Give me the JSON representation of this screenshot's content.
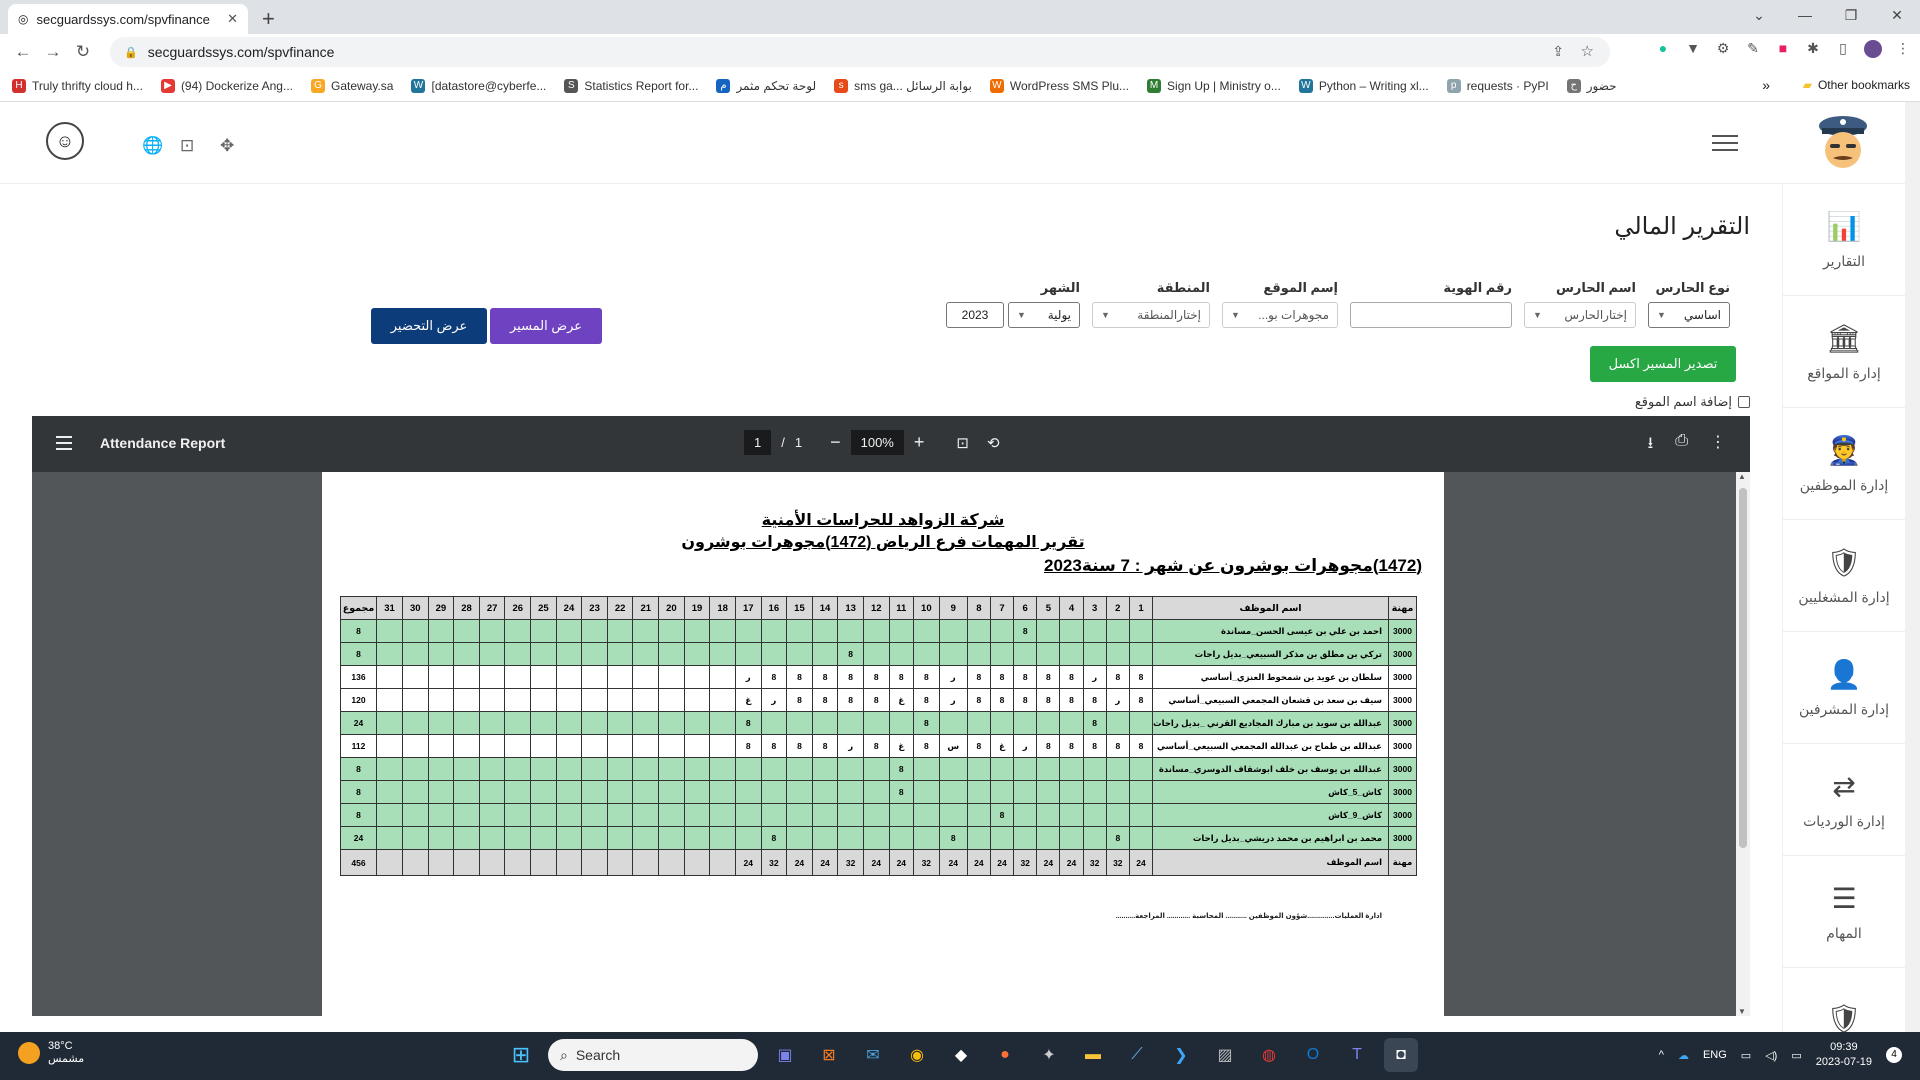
{
  "browser": {
    "tab_title": "secguardssys.com/spvfinance",
    "url": "secguardssys.com/spvfinance",
    "bookmarks": [
      {
        "label": "Truly thrifty cloud h...",
        "color": "#d32f2f",
        "glyph": "H"
      },
      {
        "label": "(94) Dockerize Ang...",
        "color": "#e53935",
        "glyph": "▶"
      },
      {
        "label": "Gateway.sa",
        "color": "#f9a825",
        "glyph": "G"
      },
      {
        "label": "[datastore@cyberfe...",
        "color": "#21759b",
        "glyph": "W"
      },
      {
        "label": "Statistics Report for...",
        "color": "#555555",
        "glyph": "S"
      },
      {
        "label": "لوحة تحكم مثمر",
        "color": "#1565c0",
        "glyph": "م"
      },
      {
        "label": "sms ga... بوابة الرسائل",
        "color": "#e64a19",
        "glyph": "s"
      },
      {
        "label": "WordPress SMS Plu...",
        "color": "#ef6c00",
        "glyph": "W"
      },
      {
        "label": "Sign Up | Ministry o...",
        "color": "#2e7d32",
        "glyph": "M"
      },
      {
        "label": "Python – Writing xl...",
        "color": "#21759b",
        "glyph": "W"
      },
      {
        "label": "requests · PyPI",
        "color": "#90a4ae",
        "glyph": "p"
      },
      {
        "label": "حضور",
        "color": "#757575",
        "glyph": "ح"
      }
    ],
    "other_bookmarks": "Other bookmarks"
  },
  "sidebar": {
    "items": [
      {
        "label": "التقارير",
        "icon": "📊"
      },
      {
        "label": "إدارة المواقع",
        "icon": "🏛"
      },
      {
        "label": "إدارة الموظفين",
        "icon": "👮"
      },
      {
        "label": "إدارة المشغليين",
        "icon": "🛡"
      },
      {
        "label": "إدارة المشرفين",
        "icon": "👤"
      },
      {
        "label": "إدارة الورديات",
        "icon": "⇄"
      },
      {
        "label": "المهام",
        "icon": "☰"
      },
      {
        "label": "",
        "icon": "🛡"
      }
    ]
  },
  "page": {
    "title": "التقرير المالي",
    "filters": {
      "guard_type": {
        "label": "نوع الحارس",
        "value": "اساسي"
      },
      "guard_name": {
        "label": "اسم الحارس",
        "value": "إختارالحارس"
      },
      "id_number": {
        "label": "رقم الهوية",
        "value": ""
      },
      "site_name": {
        "label": "إسم الموقع",
        "value": "مجوهرات بو..."
      },
      "region": {
        "label": "المنطقة",
        "value": "إختارالمنطقة"
      },
      "month": {
        "label": "الشهر",
        "value": "يولية",
        "year": "2023"
      }
    },
    "buttons": {
      "excel": "تصدير المسير اكسل",
      "route": "عرض المسير",
      "attendance": "عرض التحضير"
    },
    "checkbox_label": "إضافة اسم الموقع"
  },
  "viewer": {
    "title": "Attendance Report",
    "page_current": "1",
    "page_sep": "/",
    "page_total": "1",
    "zoom": "100%"
  },
  "report": {
    "company": "شركة الزواهد للحراسات الأمنية",
    "subtitle": "تقرير المهمات فرع الرياض (1472)مجوهرات بوشرون",
    "period": "(1472)مجوهرات بوشرون عن شهر : 7 سنة2023",
    "headers": {
      "job": "مهنة",
      "name": "اسم الموظف",
      "total": "مجموع"
    },
    "rows": [
      {
        "job": "3000",
        "name": "احمد بن علي بن عيسى الحسن_مساندة",
        "total": "8",
        "style": "g",
        "days": [
          "",
          "",
          "",
          "",
          "",
          "8",
          "",
          "",
          "",
          "",
          "",
          "",
          "",
          "",
          "",
          "",
          "",
          "",
          "",
          "",
          "",
          "",
          "",
          "",
          "",
          "",
          "",
          "",
          "",
          "",
          ""
        ]
      },
      {
        "job": "3000",
        "name": "تركي بن مطلق بن مذكر السبيعي_بديل راحات",
        "total": "8",
        "style": "g",
        "days": [
          "",
          "",
          "",
          "",
          "",
          "",
          "",
          "",
          "",
          "",
          "",
          "",
          "8",
          "",
          "",
          "",
          "",
          "",
          "",
          "",
          "",
          "",
          "",
          "",
          "",
          "",
          "",
          "",
          "",
          "",
          ""
        ]
      },
      {
        "job": "3000",
        "name": "سلطان بن عويد بن شمحوط العنزي_أساسي",
        "total": "136",
        "style": "w",
        "days": [
          "8",
          "8",
          "ر",
          "8",
          "8",
          "8",
          "8",
          "8",
          "ر",
          "8",
          "8",
          "8",
          "8",
          "8",
          "8",
          "8",
          "ر",
          "",
          "",
          "",
          "",
          "",
          "",
          "",
          "",
          "",
          "",
          "",
          "",
          "",
          ""
        ]
      },
      {
        "job": "3000",
        "name": "سيف بن سعد بن قشعان المجمعي السبيعي_أساسي",
        "total": "120",
        "style": "w",
        "days": [
          "8",
          "ر",
          "8",
          "8",
          "8",
          "8",
          "8",
          "8",
          "ر",
          "8",
          "غ",
          "8",
          "8",
          "8",
          "8",
          "ر",
          "غ",
          "",
          "",
          "",
          "",
          "",
          "",
          "",
          "",
          "",
          "",
          "",
          "",
          "",
          ""
        ]
      },
      {
        "job": "3000",
        "name": "عبدالله بن سويد بن مبارك المجاديع القرني _بديل راحات",
        "total": "24",
        "style": "g",
        "days": [
          "",
          "",
          "8",
          "",
          "",
          "",
          "",
          "",
          "",
          "8",
          "",
          "",
          "",
          "",
          "",
          "",
          "8",
          "",
          "",
          "",
          "",
          "",
          "",
          "",
          "",
          "",
          "",
          "",
          "",
          "",
          ""
        ]
      },
      {
        "job": "3000",
        "name": "عبدالله بن طماح بن عبدالله المجمعي السبيعي_أساسي",
        "total": "112",
        "style": "w",
        "days": [
          "8",
          "8",
          "8",
          "8",
          "8",
          "ر",
          "غ",
          "8",
          "س",
          "8",
          "غ",
          "8",
          "ر",
          "8",
          "8",
          "8",
          "8",
          "",
          "",
          "",
          "",
          "",
          "",
          "",
          "",
          "",
          "",
          "",
          "",
          "",
          ""
        ]
      },
      {
        "job": "3000",
        "name": "عبدالله بن يوسف بن خلف ابوشقاف الدوسري_مساندة",
        "total": "8",
        "style": "g",
        "days": [
          "",
          "",
          "",
          "",
          "",
          "",
          "",
          "",
          "",
          "",
          "8",
          "",
          "",
          "",
          "",
          "",
          "",
          "",
          "",
          "",
          "",
          "",
          "",
          "",
          "",
          "",
          "",
          "",
          "",
          "",
          ""
        ]
      },
      {
        "job": "3000",
        "name": "كاش_5_كاش",
        "total": "8",
        "style": "g",
        "days": [
          "",
          "",
          "",
          "",
          "",
          "",
          "",
          "",
          "",
          "",
          "8",
          "",
          "",
          "",
          "",
          "",
          "",
          "",
          "",
          "",
          "",
          "",
          "",
          "",
          "",
          "",
          "",
          "",
          "",
          "",
          ""
        ]
      },
      {
        "job": "3000",
        "name": "كاش_9_كاش",
        "total": "8",
        "style": "g",
        "days": [
          "",
          "",
          "",
          "",
          "",
          "",
          "8",
          "",
          "",
          "",
          "",
          "",
          "",
          "",
          "",
          "",
          "",
          "",
          "",
          "",
          "",
          "",
          "",
          "",
          "",
          "",
          "",
          "",
          "",
          "",
          ""
        ]
      },
      {
        "job": "3000",
        "name": "محمد بن ابراهيم بن محمد دريشي_بديل راحات",
        "total": "24",
        "style": "g",
        "days": [
          "",
          "8",
          "",
          "",
          "",
          "",
          "",
          "",
          "8",
          "",
          "",
          "",
          "",
          "",
          "",
          "8",
          "",
          "",
          "",
          "",
          "",
          "",
          "",
          "",
          "",
          "",
          "",
          "",
          "",
          "",
          ""
        ]
      }
    ],
    "footer": {
      "job": "مهنة",
      "name": "اسم الموظف",
      "days": [
        "24",
        "32",
        "32",
        "24",
        "24",
        "32",
        "24",
        "24",
        "24",
        "32",
        "24",
        "24",
        "32",
        "24",
        "24",
        "32",
        "24",
        "",
        "",
        "",
        "",
        "",
        "",
        "",
        "",
        "",
        "",
        "",
        "",
        "",
        ""
      ],
      "total": "456"
    },
    "signatures": "ادارة العمليات..............شؤون الموظفين ........... المحاسبة ............ المراجعة.........."
  },
  "taskbar": {
    "temp": "38°C",
    "weather": "مشمس",
    "search": "Search",
    "lang": "ENG",
    "time": "09:39",
    "date": "2023-07-19",
    "badge": "4"
  }
}
